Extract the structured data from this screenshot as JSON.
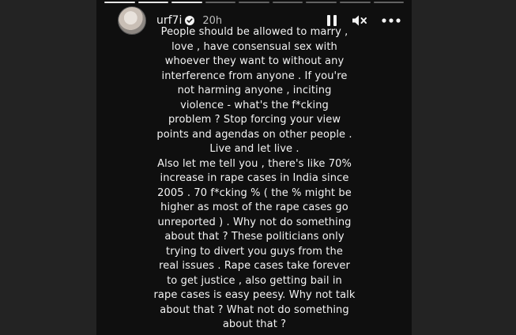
{
  "story": {
    "username": "urf7i",
    "time_ago": "20h",
    "progress_segments": [
      1,
      1,
      1,
      0,
      0,
      0,
      0,
      0,
      0
    ],
    "caption": "People should be allowed to marry ,\nlove , have consensual sex with\nwhoever they want to without any\ninterference from anyone . If you're\nnot harming anyone , inciting\nviolence - what's the f*cking\nproblem ?  Stop forcing your view\npoints and agendas on other people .\nLive and let live .\nAlso let me tell you , there's like 70%\nincrease in rape cases in India since\n2005 . 70 f*cking % ( the % might be\nhigher as most of the rape cases go\nunreported ) . Why not do something\nabout that ? These politicians only\ntrying to divert you guys from the\nreal issues .  Rape cases take forever\nto get justice ,  also getting bail in\nrape cases is easy peesy. Why not talk\nabout that ? What not do something\nabout that ?"
  },
  "icons": {
    "pause": "pause-icon",
    "mute": "speaker-muted-icon",
    "more": "more-options-icon",
    "verified": "verified-badge-icon"
  }
}
